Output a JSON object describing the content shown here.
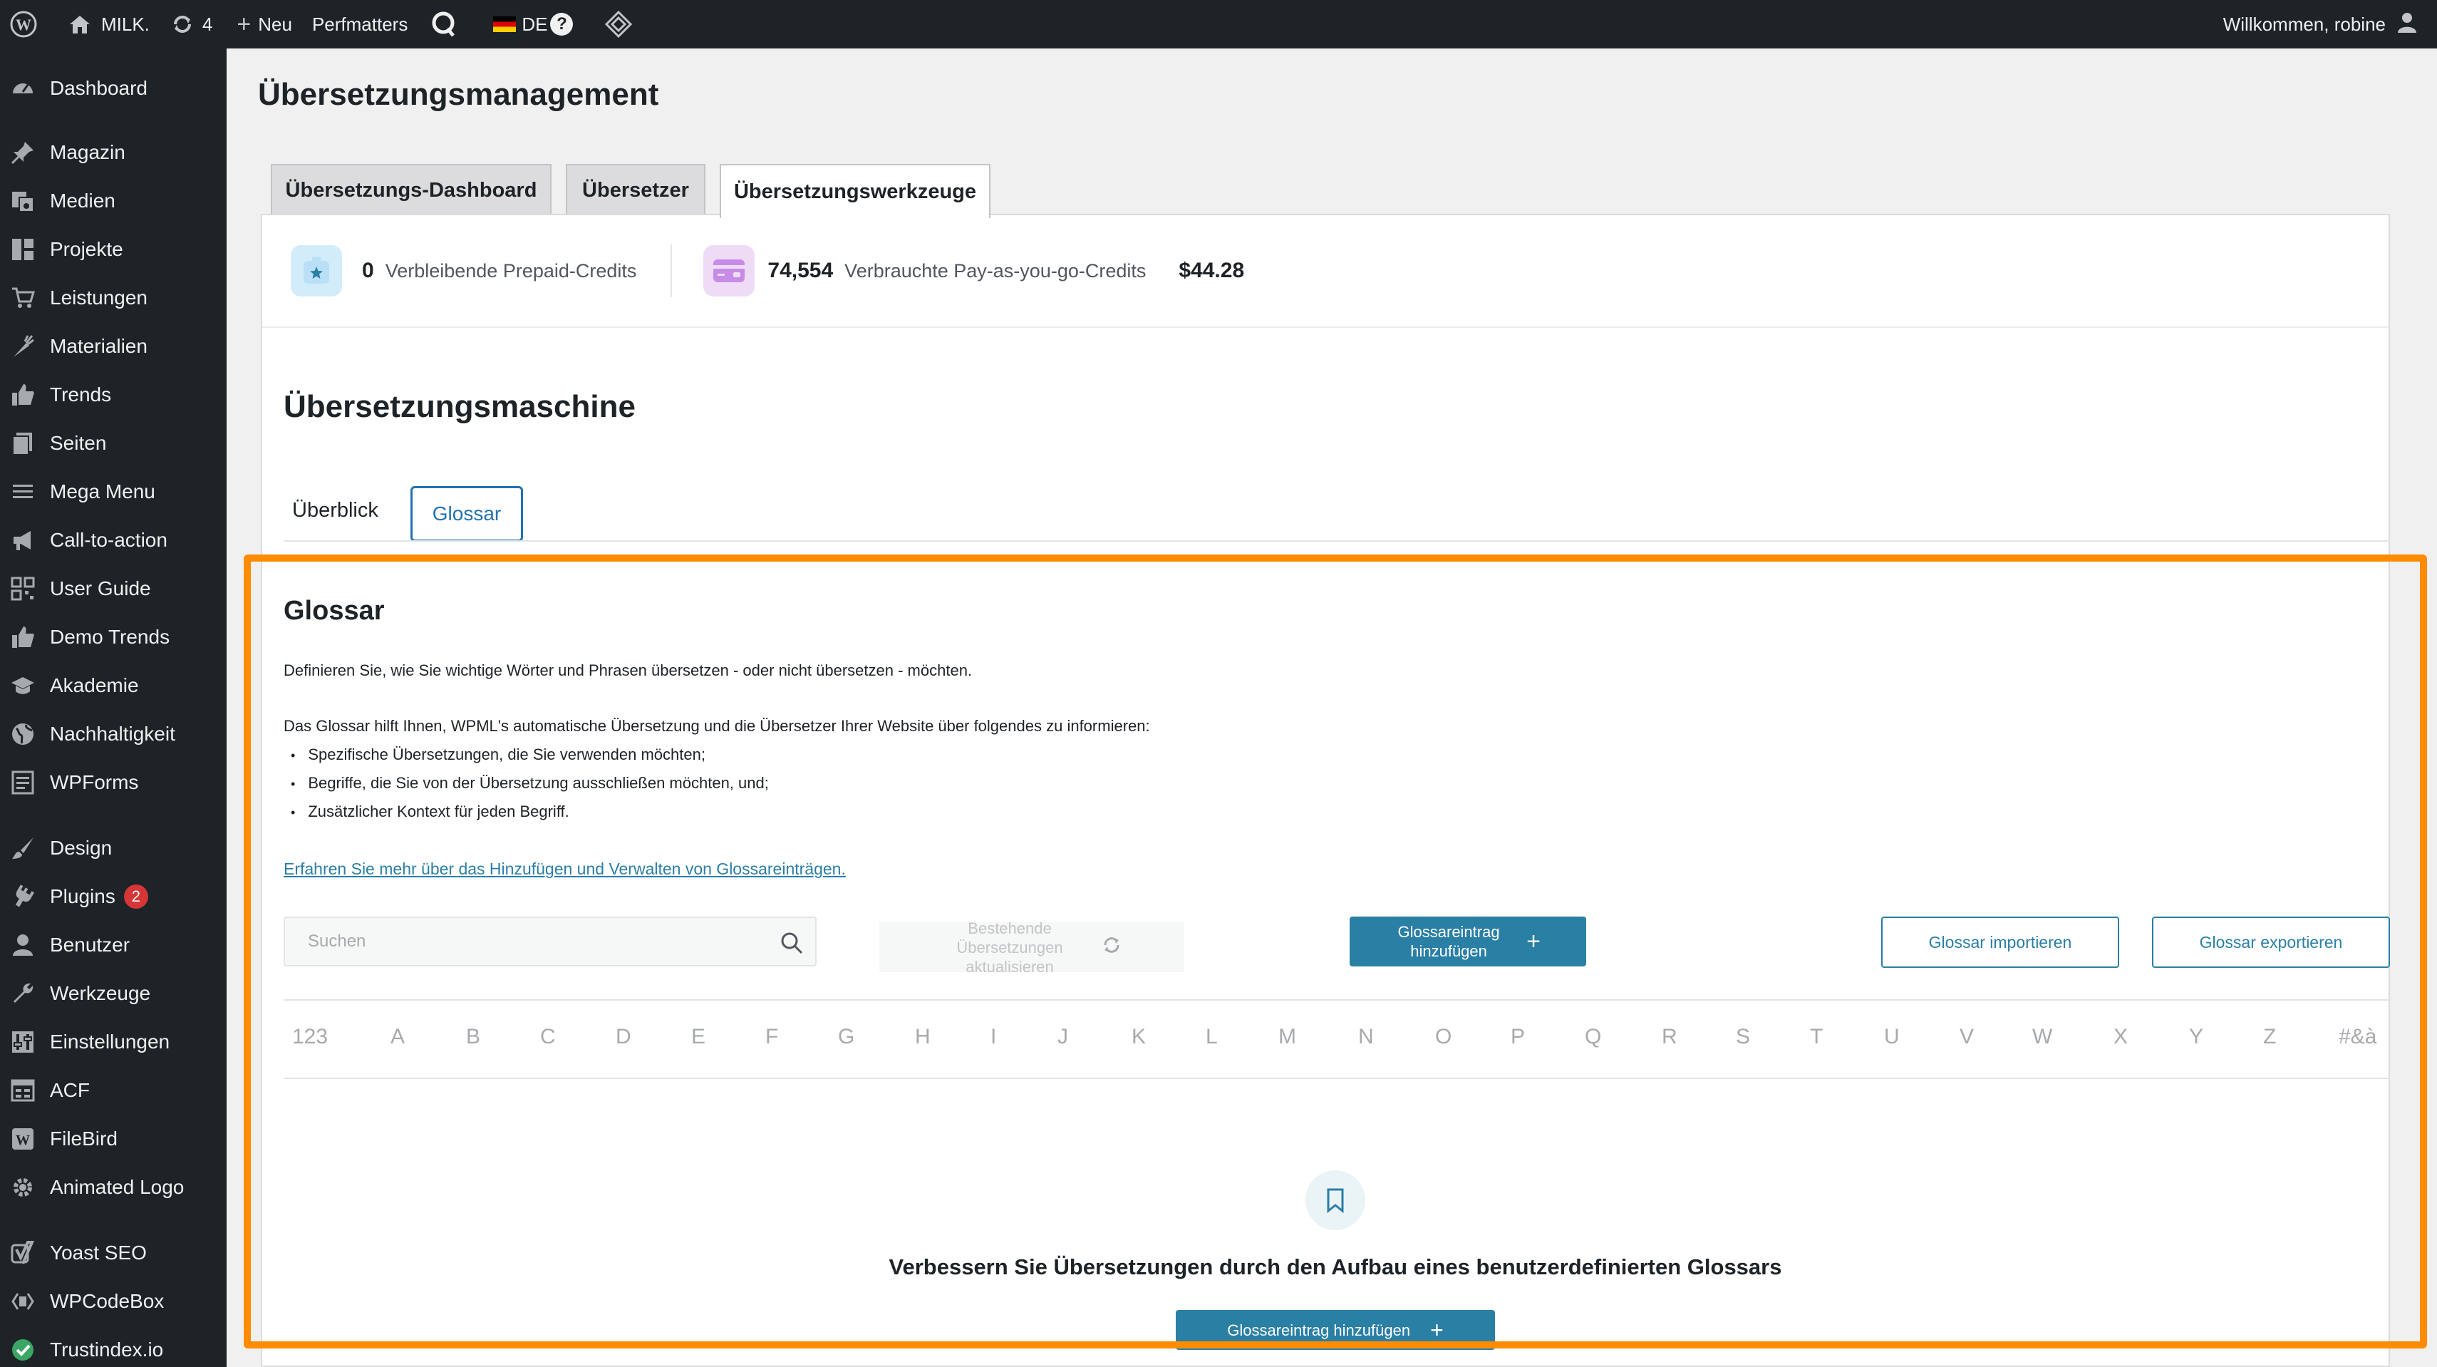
{
  "adminbar": {
    "site_name": "MILK.",
    "updates_count": "4",
    "new_label": "Neu",
    "perfmatters_label": "Perfmatters",
    "language_label": "DE",
    "welcome": "Willkommen, robine"
  },
  "sidebar": {
    "items": [
      {
        "label": "Dashboard",
        "icon": "dashboard-icon"
      },
      {
        "label": "Magazin",
        "icon": "pin-icon"
      },
      {
        "label": "Medien",
        "icon": "media-icon"
      },
      {
        "label": "Projekte",
        "icon": "grid-icon"
      },
      {
        "label": "Leistungen",
        "icon": "cart-icon"
      },
      {
        "label": "Materialien",
        "icon": "carrot-icon"
      },
      {
        "label": "Trends",
        "icon": "thumbs-up-icon"
      },
      {
        "label": "Seiten",
        "icon": "pages-icon"
      },
      {
        "label": "Mega Menu",
        "icon": "menu-icon"
      },
      {
        "label": "Call-to-action",
        "icon": "megaphone-icon"
      },
      {
        "label": "User Guide",
        "icon": "qr-icon"
      },
      {
        "label": "Demo Trends",
        "icon": "thumbs-up-icon"
      },
      {
        "label": "Akademie",
        "icon": "graduation-cap-icon"
      },
      {
        "label": "Nachhaltigkeit",
        "icon": "globe-icon"
      },
      {
        "label": "WPForms",
        "icon": "forms-icon"
      },
      {
        "label": "Design",
        "icon": "brush-icon"
      },
      {
        "label": "Plugins",
        "icon": "plugin-icon",
        "badge": "2"
      },
      {
        "label": "Benutzer",
        "icon": "user-icon"
      },
      {
        "label": "Werkzeuge",
        "icon": "wrench-icon"
      },
      {
        "label": "Einstellungen",
        "icon": "settings-icon"
      },
      {
        "label": "ACF",
        "icon": "table-icon"
      },
      {
        "label": "FileBird",
        "icon": "filebird-icon"
      },
      {
        "label": "Animated Logo",
        "icon": "gear-icon"
      },
      {
        "label": "Yoast SEO",
        "icon": "yoast-icon"
      },
      {
        "label": "WPCodeBox",
        "icon": "code-icon"
      },
      {
        "label": "Trustindex.io",
        "icon": "check-circle-icon"
      }
    ]
  },
  "page": {
    "title": "Übersetzungsmanagement",
    "tabs": [
      "Übersetzungs-Dashboard",
      "Übersetzer",
      "Übersetzungswerkzeuge"
    ]
  },
  "credits": {
    "prepaid_value": "0",
    "prepaid_label": "Verbleibende Prepaid-Credits",
    "payg_value": "74,554",
    "payg_label": "Verbrauchte Pay-as-you-go-Credits",
    "amount": "$44.28"
  },
  "machine": {
    "title": "Übersetzungsmaschine",
    "subtabs": [
      "Überblick",
      "Glossar"
    ]
  },
  "glossary": {
    "title": "Glossar",
    "intro": "Definieren Sie, wie Sie wichtige Wörter und Phrasen übersetzen - oder nicht übersetzen - möchten.",
    "info": "Das Glossar hilft Ihnen, WPML's automatische Übersetzung und die Übersetzer Ihrer Website über folgendes zu informieren:",
    "bullets": [
      "Spezifische Übersetzungen, die Sie verwenden möchten;",
      "Begriffe, die Sie von der Übersetzung ausschließen möchten, und;",
      "Zusätzlicher Kontext für jeden Begriff."
    ],
    "learn_more": "Erfahren Sie mehr über das Hinzufügen und Verwalten von Glossareinträgen.",
    "search_placeholder": "Suchen",
    "refresh_label": "Bestehende Übersetzungen aktualisieren",
    "add_label": "Glossareintrag hinzufügen",
    "import_label": "Glossar importieren",
    "export_label": "Glossar exportieren",
    "letters": [
      "123",
      "A",
      "B",
      "C",
      "D",
      "E",
      "F",
      "G",
      "H",
      "I",
      "J",
      "K",
      "L",
      "M",
      "N",
      "O",
      "P",
      "Q",
      "R",
      "S",
      "T",
      "U",
      "V",
      "W",
      "X",
      "Y",
      "Z",
      "#&à"
    ],
    "empty_title": "Verbessern Sie Übersetzungen durch den Aufbau eines benutzerdefinierten Glossars",
    "empty_add_label": "Glossareintrag hinzufügen"
  },
  "colors": {
    "accent": "#2a7fa5",
    "highlight": "#ff8c00",
    "sidebar_bg": "#1d2327"
  }
}
